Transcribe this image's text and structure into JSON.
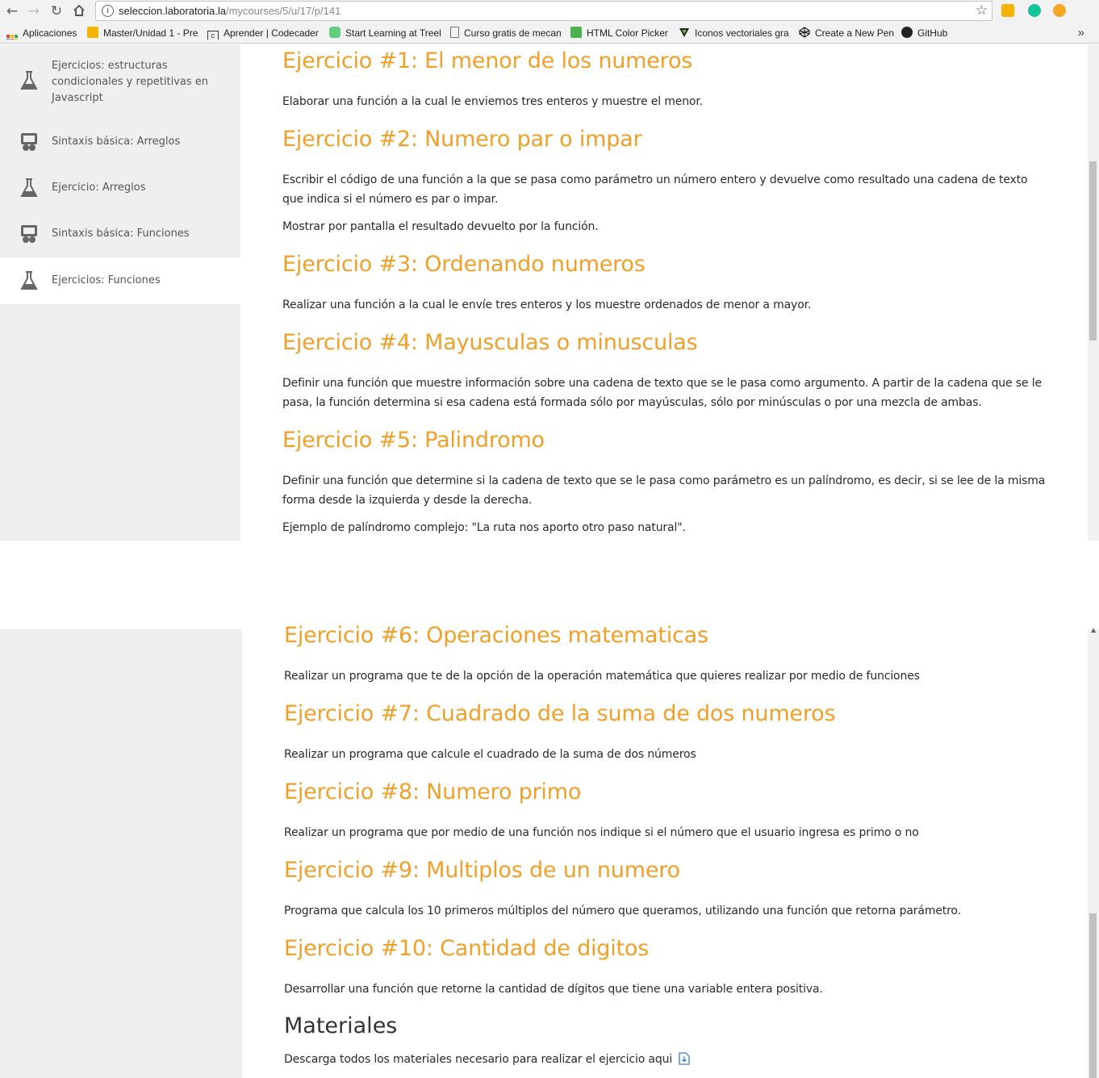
{
  "browser": {
    "url_host": "seleccion.laboratoria.la",
    "url_path": "/mycourses/5/u/17/p/141",
    "bookmarks": [
      {
        "label": "Aplicaciones",
        "icon": "apps-grid-icon"
      },
      {
        "label": "Master/Unidad 1 - Pre",
        "icon": "folder-icon"
      },
      {
        "label": "Aprender | Codecader",
        "icon": "codecademy-icon"
      },
      {
        "label": "Start Learning at Treeh",
        "icon": "treehouse-icon"
      },
      {
        "label": "Curso gratis de mecan",
        "icon": "page-icon"
      },
      {
        "label": "HTML Color Picker",
        "icon": "colorpicker-icon"
      },
      {
        "label": "Iconos vectoriales gra",
        "icon": "vector-icon"
      },
      {
        "label": "Create a New Pen",
        "icon": "codepen-icon"
      },
      {
        "label": "GitHub",
        "icon": "github-icon"
      }
    ],
    "overflow_label": "»"
  },
  "sidebar": {
    "items": [
      {
        "label_lines": [
          "Ejercicios: estructuras",
          "condicionales y repetitivas en",
          "Javascript"
        ],
        "icon": "flask-icon",
        "active": false
      },
      {
        "label_lines": [
          "Sintaxis básica: Arreglos"
        ],
        "icon": "slides-icon",
        "active": false
      },
      {
        "label_lines": [
          "Ejercicio: Arreglos"
        ],
        "icon": "flask-icon",
        "active": false
      },
      {
        "label_lines": [
          "Sintaxis básica: Funciones"
        ],
        "icon": "slides-icon",
        "active": false
      },
      {
        "label_lines": [
          "Ejercicios: Funciones"
        ],
        "icon": "flask-icon",
        "active": true
      }
    ]
  },
  "exercises": [
    {
      "title": "Ejercicio #1: El menor de los numeros",
      "paragraphs": [
        "Elaborar una función a la cual le enviemos tres enteros y muestre el menor."
      ]
    },
    {
      "title": "Ejercicio #2: Numero par o impar",
      "paragraphs": [
        "Escribir el código de una función a la que se pasa como parámetro un número entero y devuelve como resultado una cadena de texto que indica si el número es par o impar.",
        "Mostrar por pantalla el resultado devuelto por la función."
      ]
    },
    {
      "title": "Ejercicio #3: Ordenando numeros",
      "paragraphs": [
        "Realizar una función a la cual le envíe tres enteros y los muestre ordenados de menor a mayor."
      ]
    },
    {
      "title": "Ejercicio #4: Mayusculas o minusculas",
      "paragraphs": [
        "Definir una función que muestre información sobre una cadena de texto que se le pasa como argumento. A partir de la cadena que se le pasa, la función determina si esa cadena está formada sólo por mayúsculas, sólo por minúsculas o por una mezcla de ambas."
      ]
    },
    {
      "title": "Ejercicio #5: Palindromo",
      "paragraphs": [
        "Definir una función que determine si la cadena de texto que se le pasa como parámetro es un palíndromo, es decir, si se lee de la misma forma desde la izquierda y desde la derecha.",
        "Ejemplo de palíndromo complejo: \"La ruta nos aporto otro paso natural\"."
      ]
    },
    {
      "title": "Ejercicio #6: Operaciones matematicas",
      "paragraphs": [
        "Realizar un programa que te de la opción de la operación matemática que quieres realizar por medio de funciones"
      ]
    },
    {
      "title": "Ejercicio #7: Cuadrado de la suma de dos numeros",
      "paragraphs": [
        "Realizar un programa que calcule el cuadrado de la suma de dos números"
      ]
    },
    {
      "title": "Ejercicio #8: Numero primo",
      "paragraphs": [
        "Realizar un programa que por medio de una función nos indique si el número que el usuario ingresa es primo o no"
      ]
    },
    {
      "title": "Ejercicio #9: Multiplos de un numero",
      "paragraphs": [
        "Programa que calcula los 10 primeros múltiplos del número que queramos, utilizando una función que retorna parámetro."
      ]
    },
    {
      "title": "Ejercicio #10: Cantidad de digitos",
      "paragraphs": [
        "Desarrollar una función que retorne la cantidad de dígitos que tiene una variable entera positiva."
      ]
    }
  ],
  "materials": {
    "heading": "Materiales",
    "text": "Descarga todos los materiales necesario para realizar el ejercicio aqui",
    "link_icon": "download-file-icon"
  },
  "colors": {
    "accent": "#f0a028",
    "sidebar_bg": "#efefef"
  }
}
